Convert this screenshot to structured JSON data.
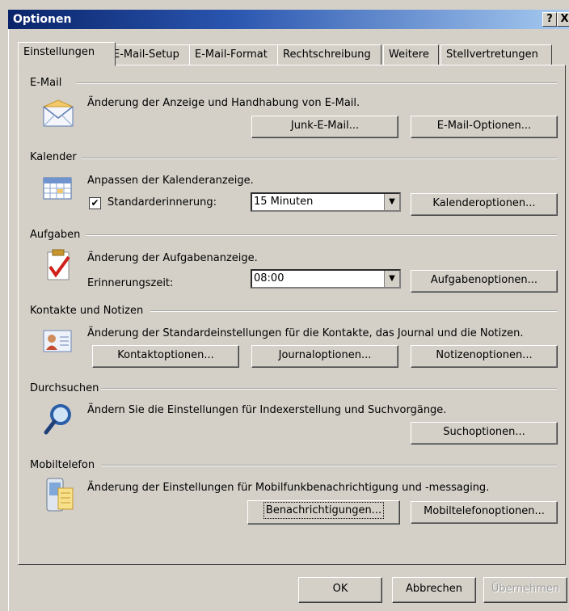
{
  "window": {
    "title": "Optionen",
    "help_label": "?",
    "close_label": "X"
  },
  "tabs": [
    {
      "label": "Einstellungen",
      "active": true
    },
    {
      "label": "E-Mail-Setup"
    },
    {
      "label": "E-Mail-Format"
    },
    {
      "label": "Rechtschreibung"
    },
    {
      "label": "Weitere"
    },
    {
      "label": "Stellvertretungen"
    }
  ],
  "email": {
    "title": "E-Mail",
    "description": "Änderung der Anzeige und Handhabung von E-Mail.",
    "junk_button": "Junk-E-Mail...",
    "options_button": "E-Mail-Optionen..."
  },
  "calendar": {
    "title": "Kalender",
    "description": "Anpassen der Kalenderanzeige.",
    "reminder_label": "Standarderinnerung:",
    "reminder_checked": true,
    "reminder_value": "15 Minuten",
    "options_button": "Kalenderoptionen..."
  },
  "tasks": {
    "title": "Aufgaben",
    "description": "Änderung der Aufgabenanzeige.",
    "reminder_time_label": "Erinnerungszeit:",
    "reminder_time_value": "08:00",
    "options_button": "Aufgabenoptionen..."
  },
  "contacts": {
    "title": "Kontakte und Notizen",
    "description": "Änderung der Standardeinstellungen für die Kontakte, das Journal und die Notizen.",
    "contact_button": "Kontaktoptionen...",
    "journal_button": "Journaloptionen...",
    "notes_button": "Notizenoptionen..."
  },
  "search": {
    "title": "Durchsuchen",
    "description": "Ändern Sie die Einstellungen für Indexerstellung und Suchvorgänge.",
    "options_button": "Suchoptionen..."
  },
  "mobile": {
    "title": "Mobiltelefon",
    "description": "Änderung der Einstellungen für Mobilfunkbenachrichtigung und -messaging.",
    "notifications_button": "Benachrichtigungen...",
    "options_button": "Mobiltelefonoptionen..."
  },
  "footer": {
    "ok": "OK",
    "cancel": "Abbrechen",
    "apply": "Übernehmen"
  },
  "colors": {
    "titlebar_start": "#0a246a",
    "titlebar_end": "#a6caf0",
    "face": "#d4d0c8"
  }
}
